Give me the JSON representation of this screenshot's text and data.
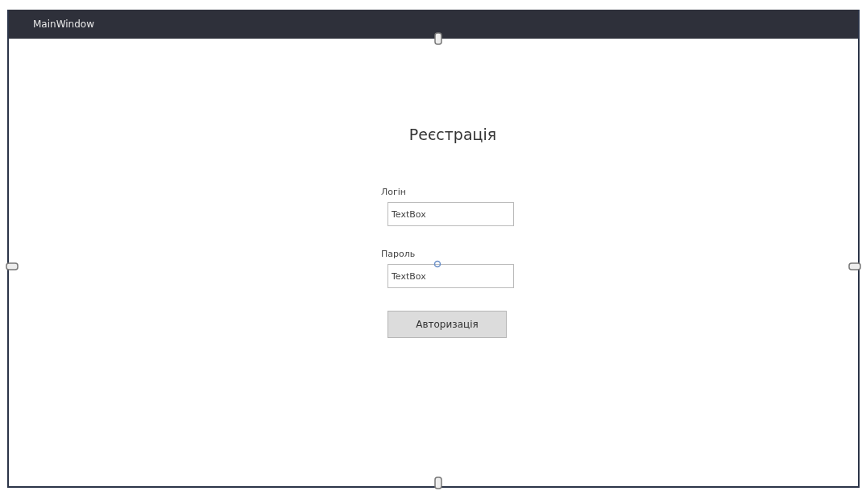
{
  "window": {
    "title": "MainWindow"
  },
  "heading": "Реєстрація",
  "fields": [
    {
      "label": "Логін",
      "value": "TextBox"
    },
    {
      "label": "Пароль",
      "value": "TextBox"
    }
  ],
  "button": "Авторизація"
}
